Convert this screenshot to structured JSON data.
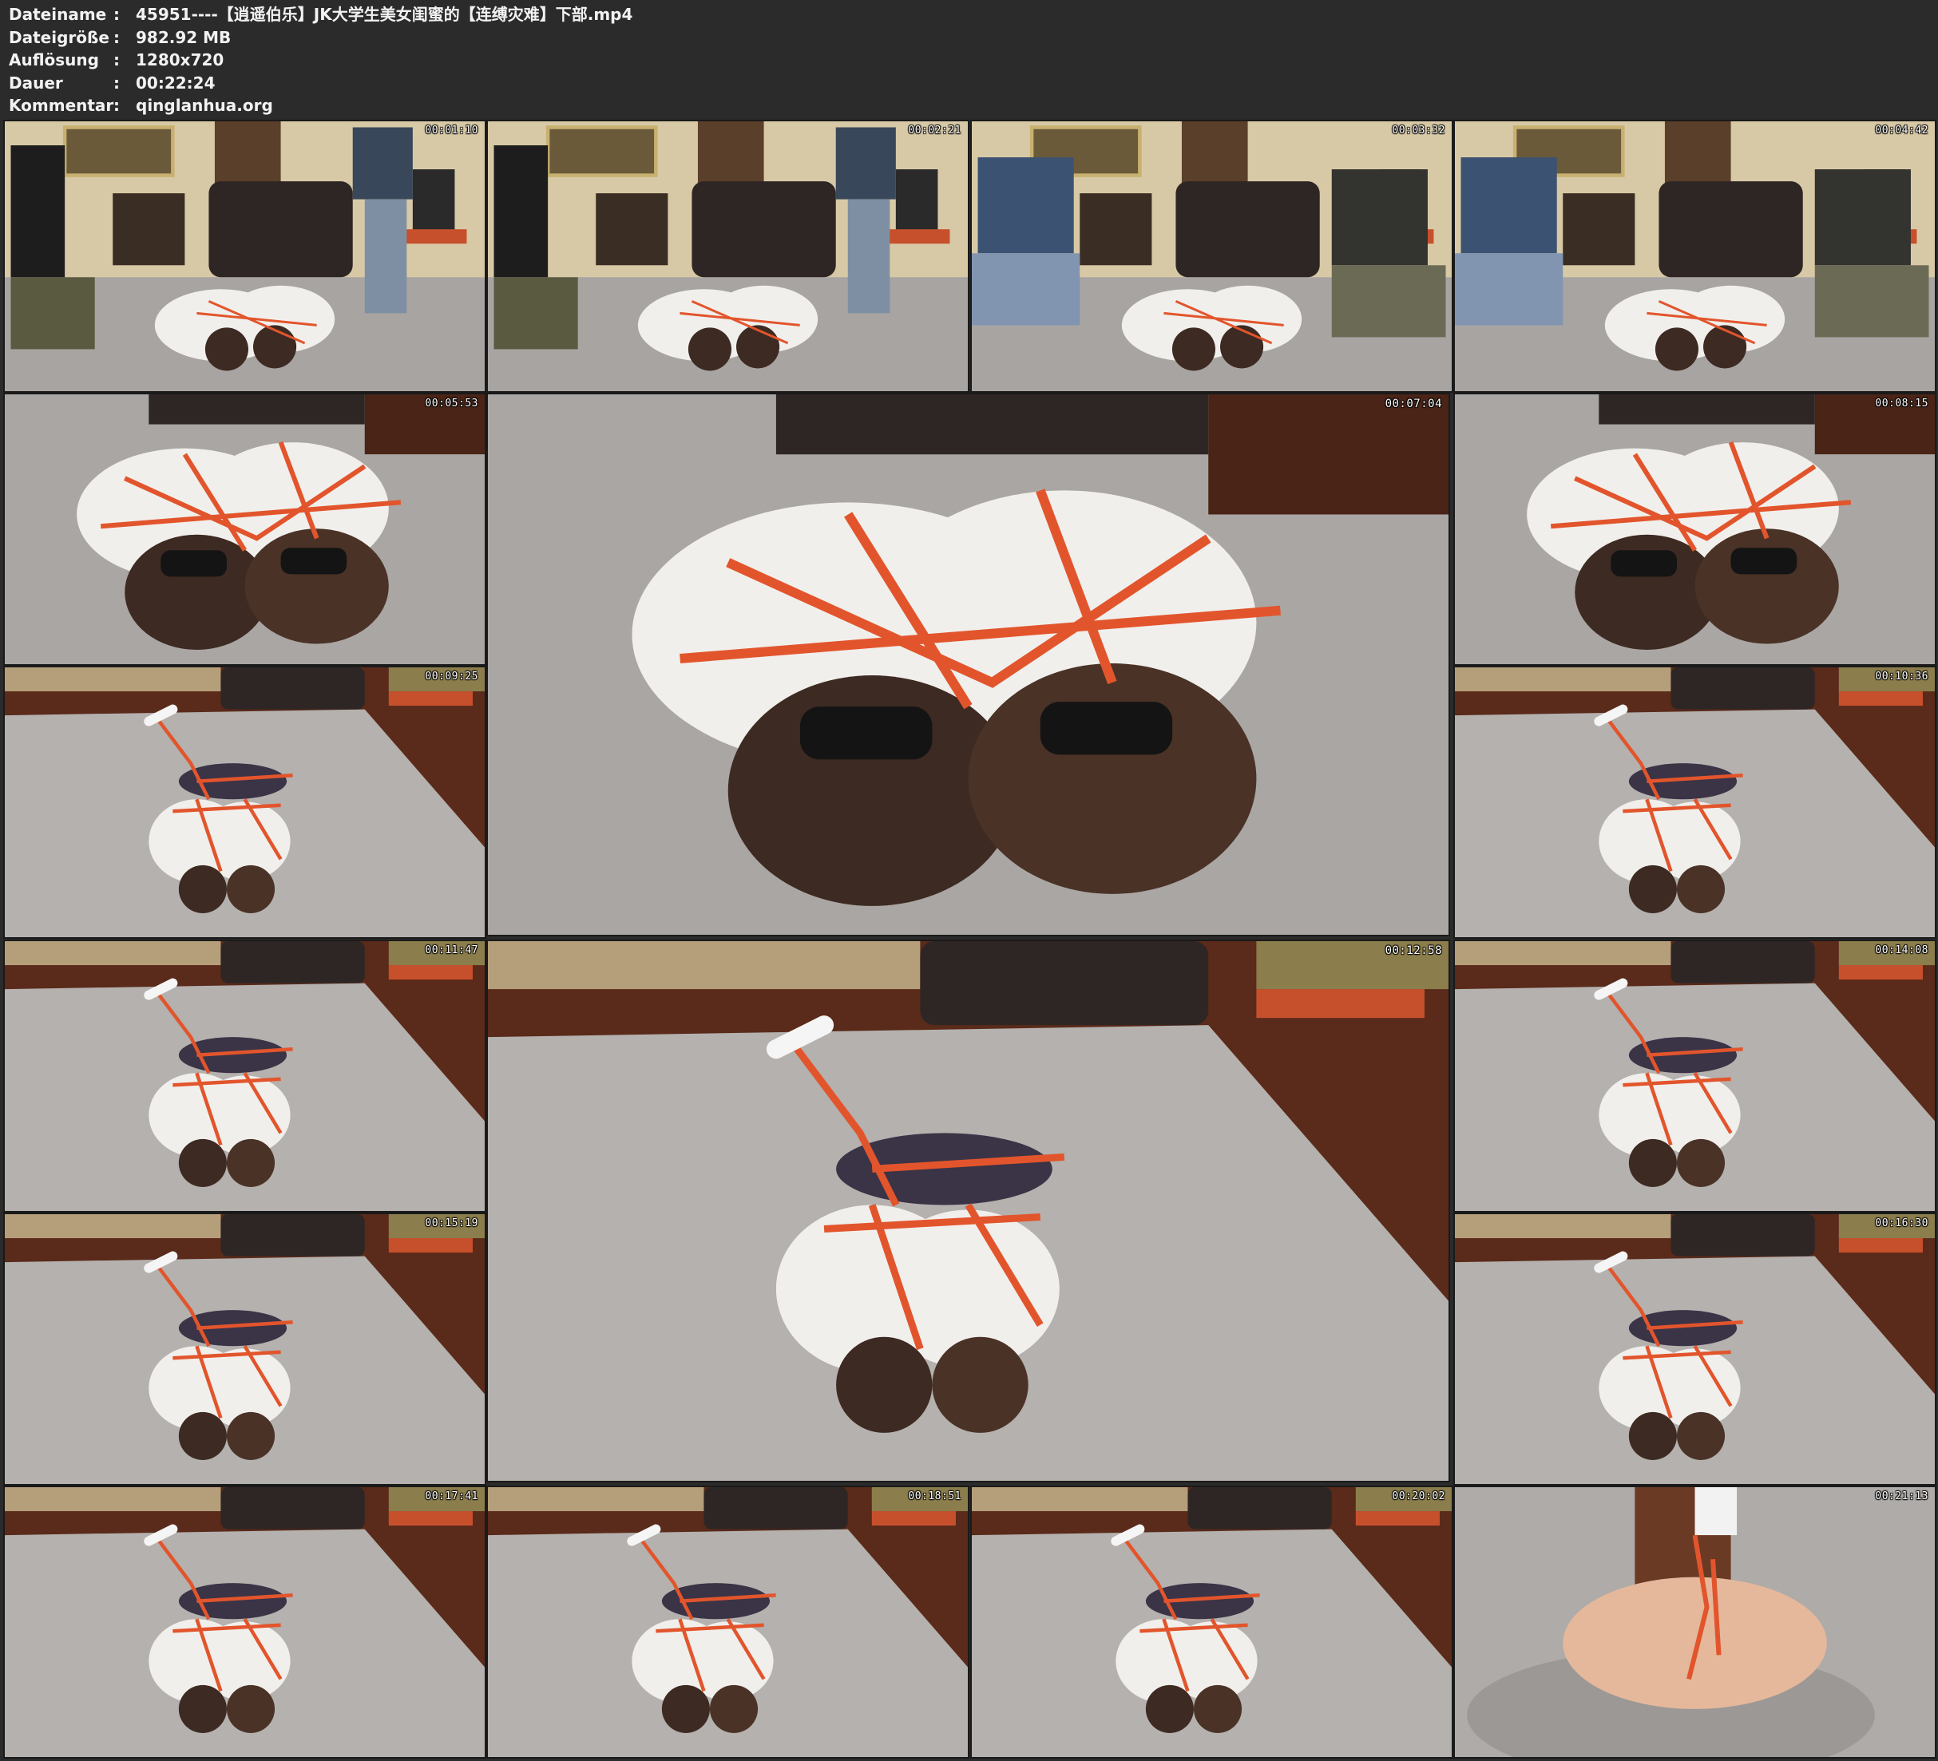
{
  "meta": {
    "filename_label": "Dateiname",
    "filename_value": "45951----【逍遥伯乐】JK大学生美女闺蜜的【连缚灾难】下部.mp4",
    "filesize_label": "Dateigröße",
    "filesize_value": "982.92 MB",
    "resolution_label": "Auflösung",
    "resolution_value": "1280x720",
    "duration_label": "Dauer",
    "duration_value": "00:22:24",
    "comment_label": "Kommentar",
    "comment_value": "qinglanhua.org",
    "separator": ":"
  },
  "frames": [
    {
      "time": "00:01:10",
      "scene": "room-two-men"
    },
    {
      "time": "00:02:21",
      "scene": "room-two-men"
    },
    {
      "time": "00:03:32",
      "scene": "room-kneel"
    },
    {
      "time": "00:04:42",
      "scene": "room-kneel"
    },
    {
      "time": "00:05:53",
      "scene": "closeup"
    },
    {
      "time": "00:07:04",
      "scene": "closeup"
    },
    {
      "time": "00:08:15",
      "scene": "closeup"
    },
    {
      "time": "00:09:25",
      "scene": "floor-wide"
    },
    {
      "time": "00:10:36",
      "scene": "floor-wide"
    },
    {
      "time": "00:11:47",
      "scene": "floor-wide"
    },
    {
      "time": "00:12:58",
      "scene": "floor-wide"
    },
    {
      "time": "00:14:08",
      "scene": "floor-wide"
    },
    {
      "time": "00:15:19",
      "scene": "floor-wide"
    },
    {
      "time": "00:16:30",
      "scene": "floor-wide"
    },
    {
      "time": "00:17:41",
      "scene": "floor-wide"
    },
    {
      "time": "00:18:51",
      "scene": "floor-wide"
    },
    {
      "time": "00:20:02",
      "scene": "floor-wide"
    },
    {
      "time": "00:21:13",
      "scene": "handheld"
    }
  ],
  "colors": {
    "background": "#2b2b2b",
    "carpet": "#b9b6b3",
    "floor_wood": "#5a2a1a",
    "rope": "#e2552c",
    "shirt": "#f1efec",
    "hair": "#3d2a22",
    "sofa": "#2e2624"
  }
}
